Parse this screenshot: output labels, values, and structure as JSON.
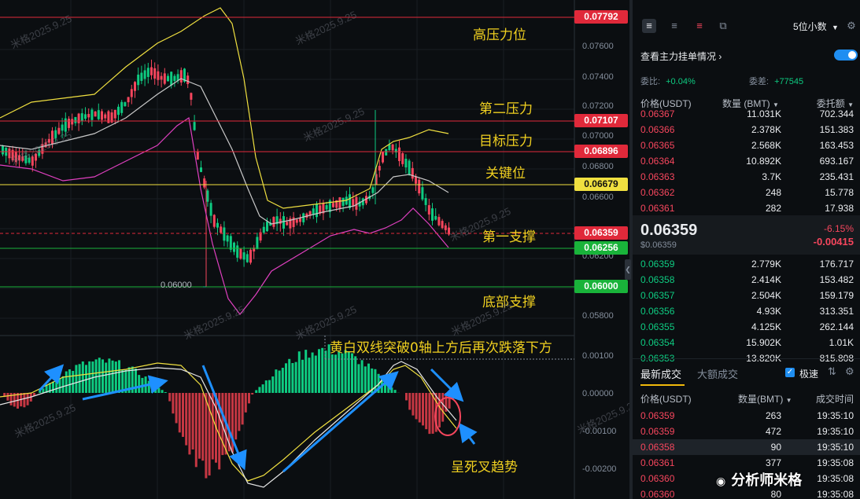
{
  "chart": {
    "price_axis_labels": [
      "0.07600",
      "0.07400",
      "0.07200",
      "0.07000",
      "0.06800",
      "0.06600",
      "0.06200",
      "0.05800"
    ],
    "macd_axis_labels": [
      "0.00100",
      "0.00000",
      "-0.00100",
      "-0.00200"
    ],
    "levels": [
      {
        "value": "0.07792",
        "color": "#e0293a",
        "label": "高压力位"
      },
      {
        "value": "0.07107",
        "color": "#e0293a",
        "label": "第二压力"
      },
      {
        "value": "0.06896",
        "color": "#e0293a",
        "label": "目标压力"
      },
      {
        "value": "0.06679",
        "color": "#f0e040",
        "label": "关键位"
      },
      {
        "value": "0.06359",
        "color": "#e0293a",
        "label": "第一支撑"
      },
      {
        "value": "0.06256",
        "color": "#19b33a",
        "label": ""
      },
      {
        "value": "0.06000",
        "color": "#19b33a",
        "label": "底部支撑"
      }
    ],
    "low_marker_text": "0.06000",
    "macd_annotation": "黄白双线突破0轴上方后再次跌落下方",
    "cross_annotation": "呈死叉趋势",
    "watermark": "米格2025.9.25"
  },
  "panel": {
    "precision_label": "5位小数",
    "view_orderbook_label": "查看主力挂单情况",
    "ratio_label": "委比:",
    "ratio_value": "+0.04%",
    "diff_label": "委差:",
    "diff_value": "+77545",
    "headers": {
      "price": "价格(USDT)",
      "qty": "数量 (BMT)",
      "total": "委托额"
    },
    "asks": [
      {
        "price": "0.06367",
        "qty": "11.031K",
        "total": "702.344"
      },
      {
        "price": "0.06366",
        "qty": "2.378K",
        "total": "151.383"
      },
      {
        "price": "0.06365",
        "qty": "2.568K",
        "total": "163.453"
      },
      {
        "price": "0.06364",
        "qty": "10.892K",
        "total": "693.167"
      },
      {
        "price": "0.06363",
        "qty": "3.7K",
        "total": "235.431"
      },
      {
        "price": "0.06362",
        "qty": "248",
        "total": "15.778"
      },
      {
        "price": "0.06361",
        "qty": "282",
        "total": "17.938"
      }
    ],
    "last_price": "0.06359",
    "last_price_usd": "$0.06359",
    "change_pct": "-6.15%",
    "change_abs": "-0.00415",
    "bids": [
      {
        "price": "0.06359",
        "qty": "2.779K",
        "total": "176.717"
      },
      {
        "price": "0.06358",
        "qty": "2.414K",
        "total": "153.482"
      },
      {
        "price": "0.06357",
        "qty": "2.504K",
        "total": "159.179"
      },
      {
        "price": "0.06356",
        "qty": "4.93K",
        "total": "313.351"
      },
      {
        "price": "0.06355",
        "qty": "4.125K",
        "total": "262.144"
      },
      {
        "price": "0.06354",
        "qty": "15.902K",
        "total": "1.01K"
      },
      {
        "price": "0.06353",
        "qty": "13.820K",
        "total": "815.808"
      }
    ],
    "trades_tab_latest": "最新成交",
    "trades_tab_large": "大额成交",
    "fast_label": "极速",
    "trade_headers": {
      "price": "价格(USDT)",
      "qty": "数量(BMT)",
      "time": "成交时间"
    },
    "trades": [
      {
        "price": "0.06359",
        "qty": "263",
        "time": "19:35:10",
        "side": "red"
      },
      {
        "price": "0.06359",
        "qty": "472",
        "time": "19:35:10",
        "side": "red"
      },
      {
        "price": "0.06358",
        "qty": "90",
        "time": "19:35:10",
        "side": "red"
      },
      {
        "price": "0.06361",
        "qty": "377",
        "time": "19:35:08",
        "side": "red"
      },
      {
        "price": "0.06360",
        "qty": "1",
        "time": "19:35:08",
        "side": "red"
      },
      {
        "price": "0.06360",
        "qty": "80",
        "time": "19:35:08",
        "side": "red"
      }
    ],
    "brand_watermark": "分析师米格"
  }
}
